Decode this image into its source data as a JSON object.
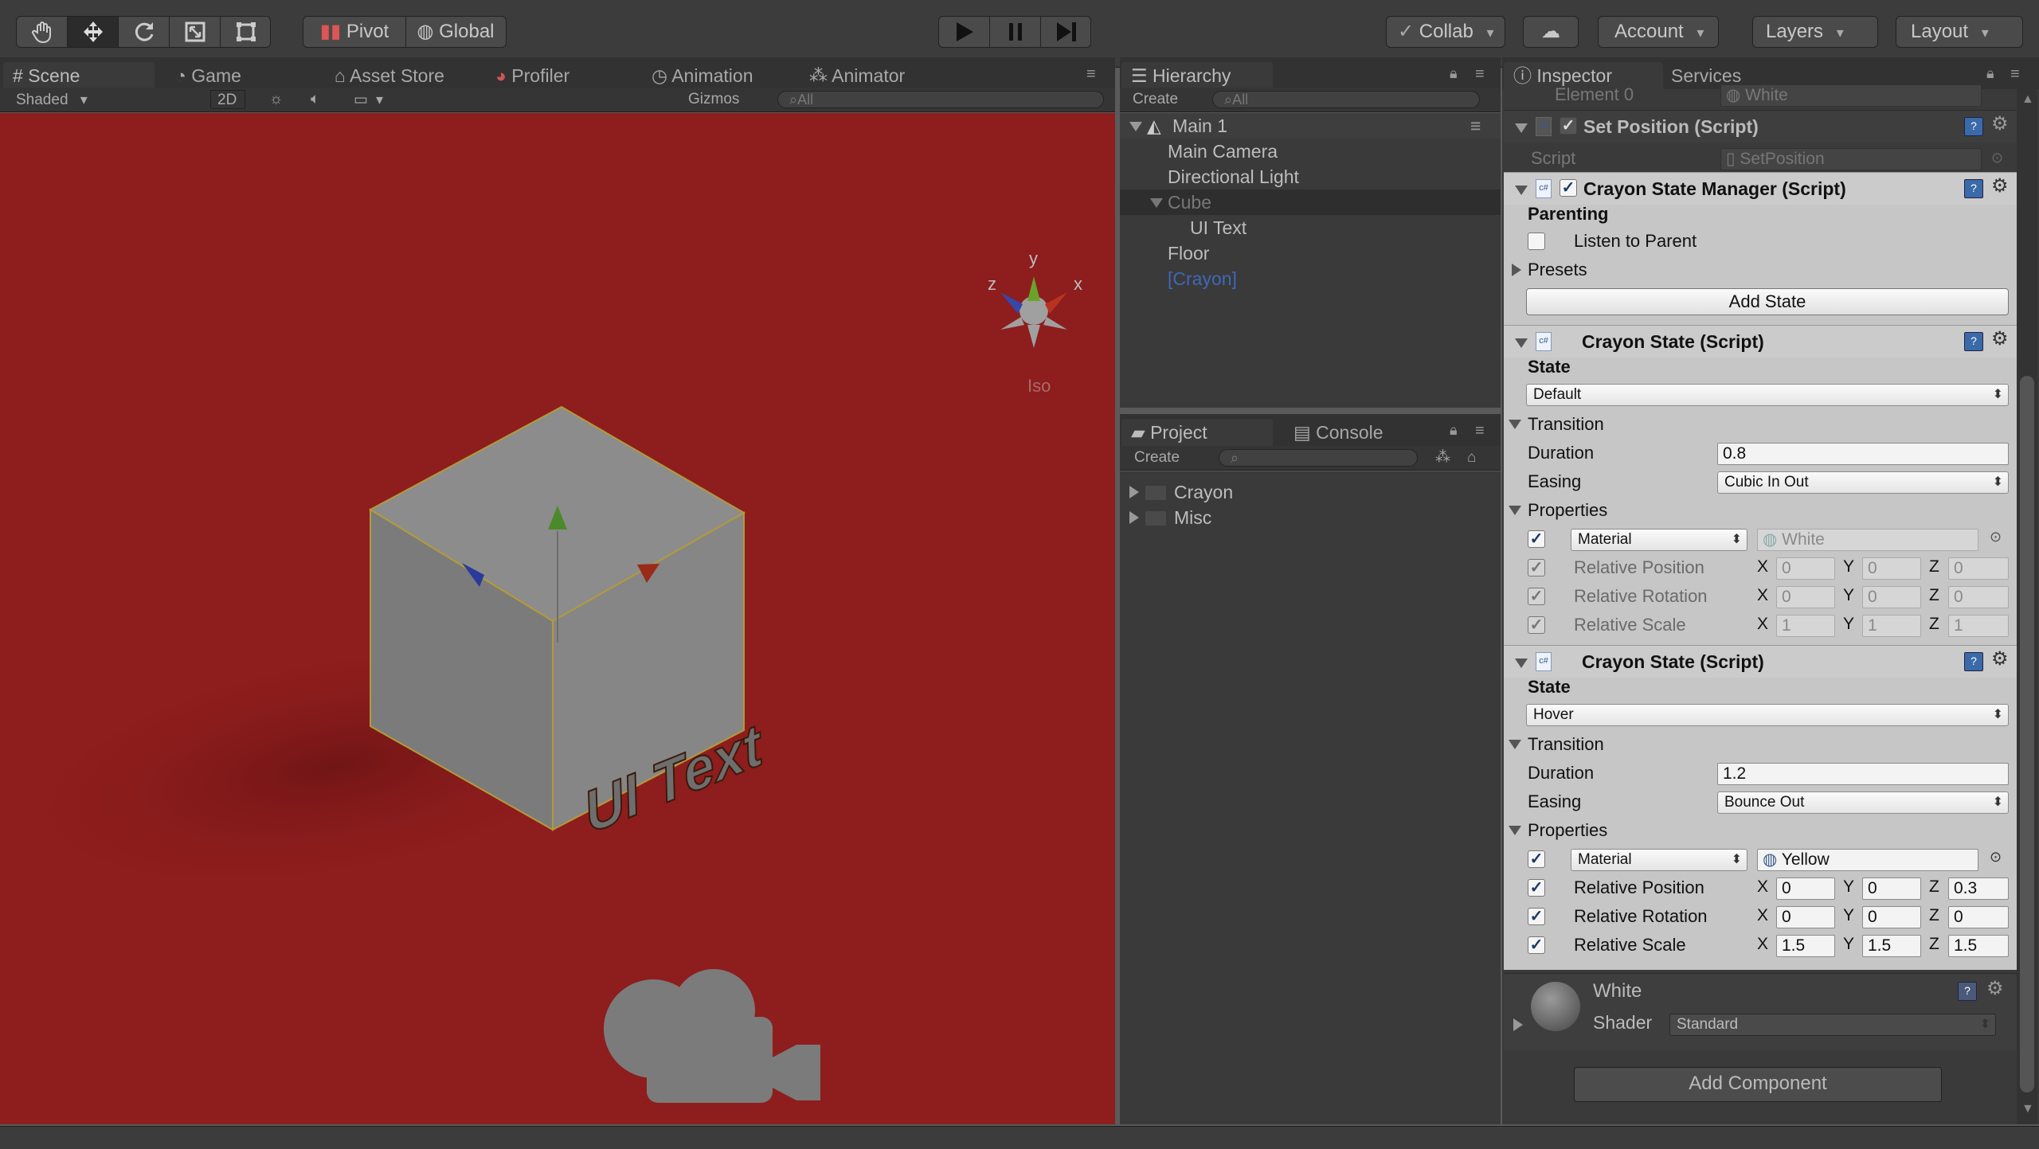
{
  "toolbar": {
    "pivot": "Pivot",
    "global": "Global",
    "collab": "Collab",
    "account": "Account",
    "layers": "Layers",
    "layout": "Layout"
  },
  "scene_tabs": [
    "Scene",
    "Game",
    "Asset Store",
    "Profiler",
    "Animation",
    "Animator"
  ],
  "scene_bar": {
    "shading": "Shaded",
    "mode2d": "2D",
    "gizmos": "Gizmos",
    "search": "All",
    "iso": "Iso",
    "axis_x": "x",
    "axis_y": "y",
    "axis_z": "z"
  },
  "scene": {
    "cube_text": "UI Text"
  },
  "hierarchy": {
    "tab": "Hierarchy",
    "create": "Create",
    "search": "All",
    "scene_name": "Main 1",
    "items": [
      "Main Camera",
      "Directional Light",
      "Cube",
      "UI Text",
      "Floor",
      "[Crayon]"
    ]
  },
  "project": {
    "tab": "Project",
    "console_tab": "Console",
    "create": "Create",
    "folders": [
      "Crayon",
      "Misc"
    ]
  },
  "inspector": {
    "tab": "Inspector",
    "services_tab": "Services",
    "element0_label": "Element 0",
    "element0_value": "White",
    "set_position": {
      "title": "Set Position (Script)",
      "script_label": "Script",
      "script_value": "SetPosition"
    },
    "manager": {
      "title": "Crayon State Manager (Script)",
      "parenting": "Parenting",
      "listen": "Listen to Parent",
      "presets": "Presets",
      "add_state": "Add State"
    },
    "states": [
      {
        "title": "Crayon State (Script)",
        "state_label": "State",
        "state_value": "Default",
        "transition": "Transition",
        "duration_label": "Duration",
        "duration": "0.8",
        "easing_label": "Easing",
        "easing": "Cubic In Out",
        "properties": "Properties",
        "material_type": "Material",
        "material_value": "White",
        "rel_pos": "Relative Position",
        "rel_rot": "Relative Rotation",
        "rel_scale": "Relative Scale",
        "pos": [
          "0",
          "0",
          "0"
        ],
        "rot": [
          "0",
          "0",
          "0"
        ],
        "scale": [
          "1",
          "1",
          "1"
        ]
      },
      {
        "title": "Crayon State (Script)",
        "state_label": "State",
        "state_value": "Hover",
        "transition": "Transition",
        "duration_label": "Duration",
        "duration": "1.2",
        "easing_label": "Easing",
        "easing": "Bounce Out",
        "properties": "Properties",
        "material_type": "Material",
        "material_value": "Yellow",
        "rel_pos": "Relative Position",
        "rel_rot": "Relative Rotation",
        "rel_scale": "Relative Scale",
        "pos": [
          "0",
          "0",
          "0.3"
        ],
        "rot": [
          "0",
          "0",
          "0"
        ],
        "scale": [
          "1.5",
          "1.5",
          "1.5"
        ]
      }
    ],
    "axes": [
      "X",
      "Y",
      "Z"
    ],
    "material": {
      "name": "White",
      "shader_label": "Shader",
      "shader": "Standard"
    },
    "add_component": "Add Component"
  },
  "colors": {
    "scene_bg": "#8e1d1d",
    "panel": "#3a3a3a",
    "inspector_light": "#c6c6c6",
    "check": "#1a3a66"
  }
}
